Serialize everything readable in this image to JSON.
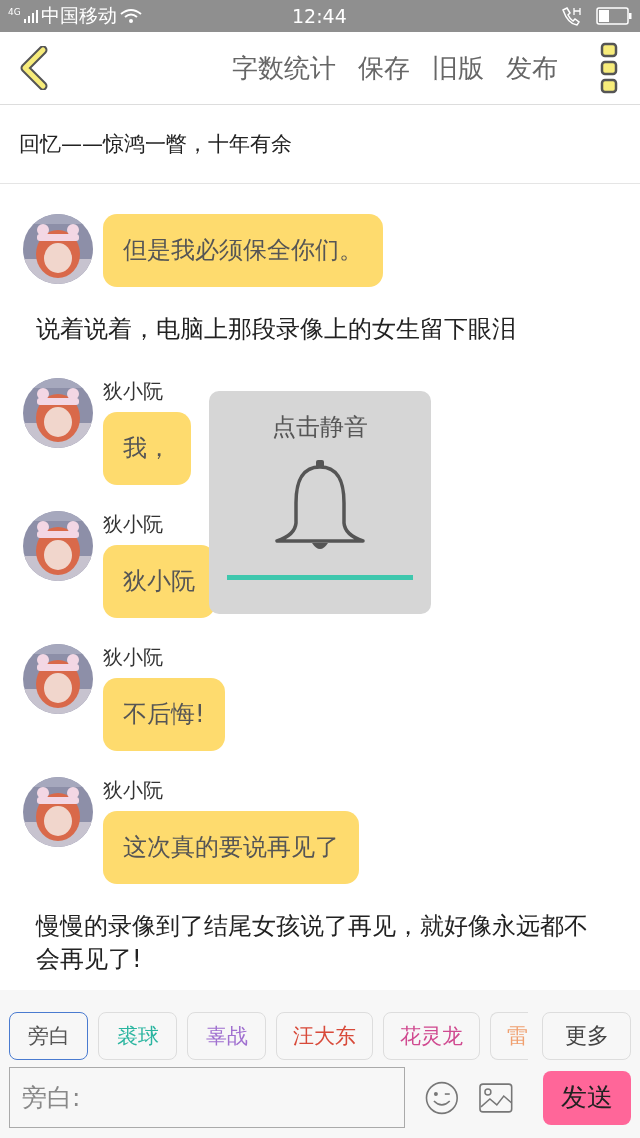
{
  "status_bar": {
    "network": "4G",
    "carrier": "中国移动",
    "time": "12:44"
  },
  "toolbar": {
    "actions": [
      "字数统计",
      "保存",
      "旧版",
      "发布"
    ]
  },
  "chapter_title": "回忆——惊鸿一瞥，十年有余",
  "messages": [
    {
      "kind": "bubble",
      "text": "但是我必须保全你们。"
    },
    {
      "kind": "narration",
      "text": "说着说着，电脑上那段录像上的女生留下眼泪"
    },
    {
      "kind": "bubble",
      "name": "狄小阮",
      "text": "我，"
    },
    {
      "kind": "bubble",
      "name": "狄小阮",
      "text": "狄小阮"
    },
    {
      "kind": "bubble",
      "name": "狄小阮",
      "text": "不后悔!"
    },
    {
      "kind": "bubble",
      "name": "狄小阮",
      "text": "这次真的要说再见了"
    },
    {
      "kind": "narration",
      "text": "慢慢的录像到了结尾女孩说了再见，就好像永远都不会再见了!"
    }
  ],
  "mute_popup": {
    "title": "点击静音"
  },
  "roles": [
    {
      "label": "旁白",
      "selected": true,
      "color": "#555555"
    },
    {
      "label": "裘球",
      "selected": false,
      "color": "#2bb5a0"
    },
    {
      "label": "辜战",
      "selected": false,
      "color": "#a070d0"
    },
    {
      "label": "汪大东",
      "selected": false,
      "color": "#d84a3a"
    },
    {
      "label": "花灵龙",
      "selected": false,
      "color": "#d04a90"
    },
    {
      "label": "雷",
      "selected": false,
      "color": "#f0a070"
    }
  ],
  "more_button": "更多",
  "input": {
    "placeholder": "旁白:"
  },
  "send_button": "发送"
}
